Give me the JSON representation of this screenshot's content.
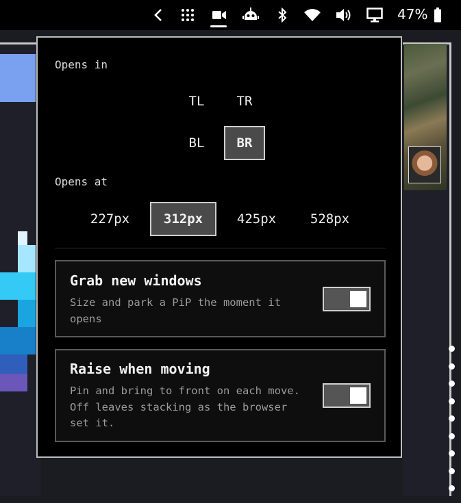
{
  "topbar": {
    "icons": [
      "chevron-left-icon",
      "grid-dots-icon",
      "video-camera-icon",
      "robot-icon",
      "bluetooth-icon",
      "wifi-icon",
      "volume-icon",
      "monitor-icon",
      "battery-icon"
    ],
    "battery_percent": "47%"
  },
  "panel": {
    "opens_in": {
      "label": "Opens in",
      "corners": [
        {
          "label": "TL",
          "selected": false
        },
        {
          "label": "TR",
          "selected": false
        },
        {
          "label": "BL",
          "selected": false
        },
        {
          "label": "BR",
          "selected": true
        }
      ]
    },
    "opens_at": {
      "label": "Opens at",
      "sizes": [
        {
          "label": "227px",
          "selected": false
        },
        {
          "label": "312px",
          "selected": true
        },
        {
          "label": "425px",
          "selected": false
        },
        {
          "label": "528px",
          "selected": false
        }
      ]
    },
    "options": [
      {
        "title": "Grab new windows",
        "description": "Size and park a PiP the moment it opens",
        "enabled": true
      },
      {
        "title": "Raise when moving",
        "description": "Pin and bring to front on each move. Off leaves stacking as the browser set it.",
        "enabled": true
      }
    ]
  },
  "colors": {
    "panel_bg": "#000000",
    "panel_border": "#bdbdbd",
    "selected_bg": "#4a4a4a",
    "toggle_on_track": "#555555",
    "topbar_bg": "#000000"
  }
}
